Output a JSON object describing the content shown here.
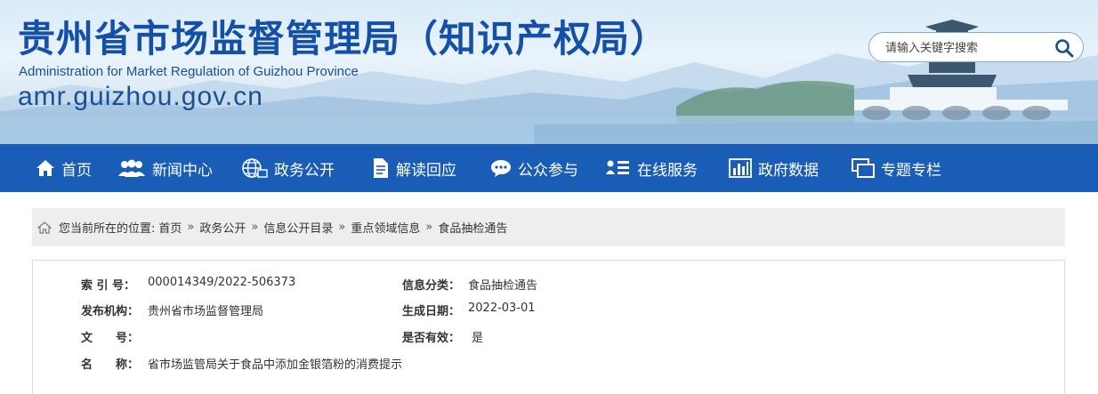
{
  "header": {
    "title": "贵州省市场监督管理局（知识产权局）",
    "subtitle": "Administration for Market Regulation of Guizhou Province",
    "domain": "amr.guizhou.gov.cn",
    "search": {
      "placeholder": "请输入关键字搜索",
      "icon": "search-icon"
    }
  },
  "nav": {
    "items": [
      {
        "label": "首页",
        "icon": "home-icon"
      },
      {
        "label": "新闻中心",
        "icon": "people-icon"
      },
      {
        "label": "政务公开",
        "icon": "globe-icon"
      },
      {
        "label": "解读回应",
        "icon": "document-icon"
      },
      {
        "label": "公众参与",
        "icon": "chat-icon"
      },
      {
        "label": "在线服务",
        "icon": "user-list-icon"
      },
      {
        "label": "政府数据",
        "icon": "bar-chart-icon"
      },
      {
        "label": "专题专栏",
        "icon": "windows-icon"
      }
    ]
  },
  "breadcrumb": {
    "prefix": "您当前所在的位置:",
    "separator": "»",
    "items": [
      "首页",
      "政务公开",
      "信息公开目录",
      "重点领域信息",
      "食品抽检通告"
    ]
  },
  "info": {
    "index_no": {
      "label": "索 引 号：",
      "value": "000014349/2022-506373"
    },
    "category": {
      "label": "信息分类：",
      "value": "食品抽检通告"
    },
    "publisher": {
      "label": "发布机构：",
      "value": "贵州省市场监督管理局"
    },
    "date": {
      "label": "生成日期：",
      "value": "2022-03-01"
    },
    "doc_no": {
      "label": "文　　号：",
      "value": ""
    },
    "valid": {
      "label": "是否有效：",
      "value": "是"
    },
    "name": {
      "label": "名　　称：",
      "value": "省市场监管局关于食品中添加金银箔粉的消费提示"
    }
  },
  "colors": {
    "nav_bg": "#1a5db6",
    "title": "#1550a8",
    "breadcrumb_bg": "#eeeeee"
  }
}
